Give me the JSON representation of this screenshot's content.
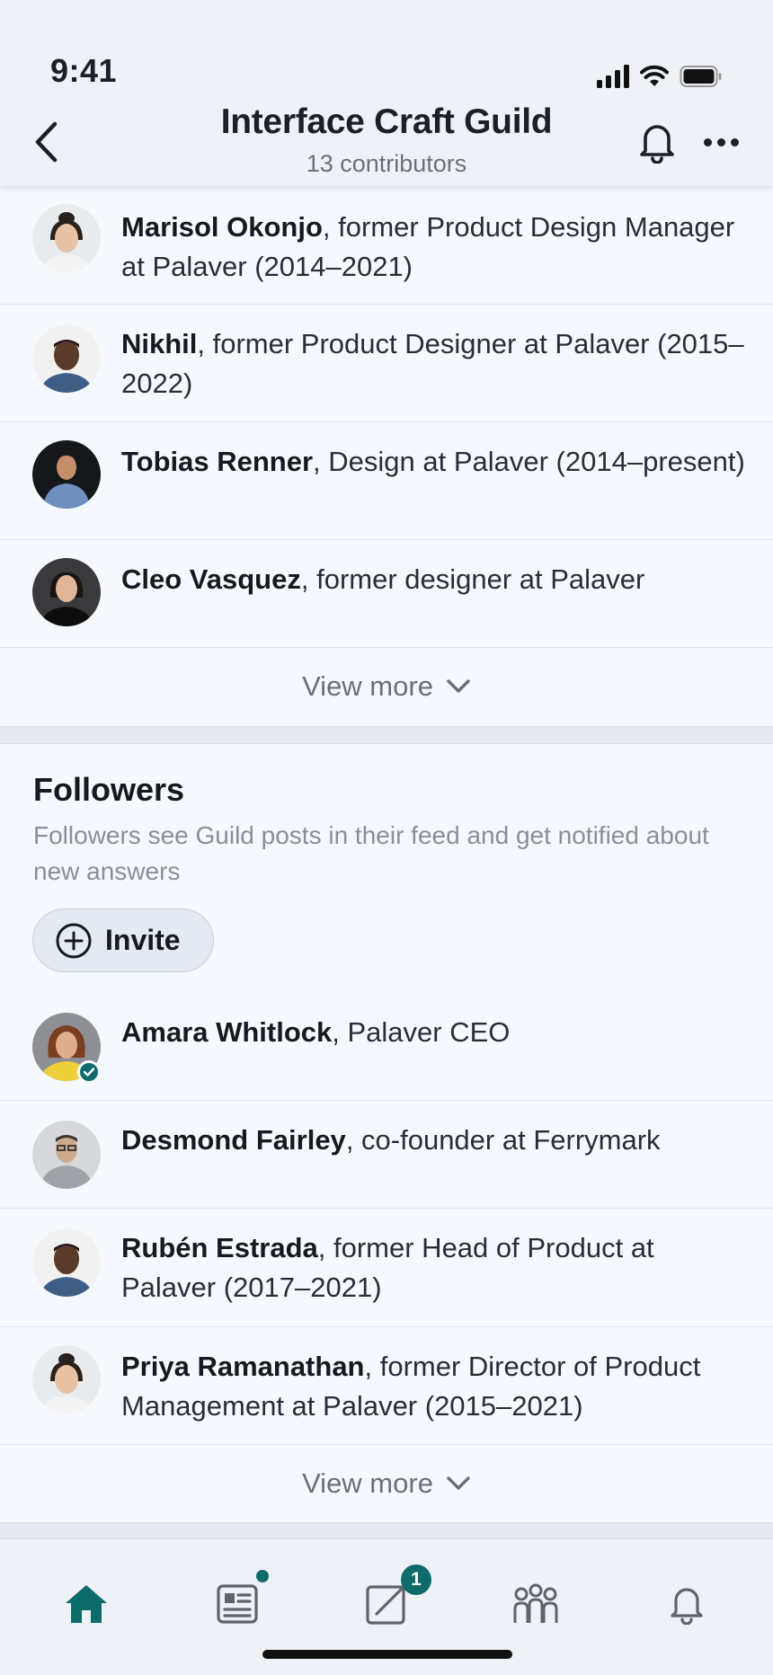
{
  "status_bar": {
    "time": "9:41"
  },
  "header": {
    "title": "Interface Craft Guild",
    "subtitle": "13 contributors"
  },
  "contributors": [
    {
      "name": "Marisol Okonjo",
      "detail": ", former Product Design Manager at Palaver (2014–2021)"
    },
    {
      "name": "Nikhil",
      "detail": ", former Product Designer at Palaver (2015–2022)"
    },
    {
      "name": "Tobias Renner",
      "detail": ", Design at Palaver (2014–present)"
    },
    {
      "name": "Cleo Vasquez",
      "detail": ", former designer at Palaver"
    }
  ],
  "contributors_view_more": "View more",
  "followers": {
    "title": "Followers",
    "description": "Followers see Guild posts in their feed and get notified about new answers",
    "invite_label": "Invite",
    "items": [
      {
        "name": "Amara Whitlock",
        "detail": ", Palaver CEO"
      },
      {
        "name": "Desmond Fairley",
        "detail": ", co-founder at Ferrymark"
      },
      {
        "name": "Rubén Estrada",
        "detail": ", former Head of Product at Palaver (2017–2021)"
      },
      {
        "name": "Priya Ramanathan",
        "detail": ", former Director of Product Management at Palaver (2015–2021)"
      }
    ],
    "view_more": "View more"
  },
  "tabbar": {
    "notes_badge": "1"
  },
  "colors": {
    "accent": "#0e6b6b",
    "background": "#f5f9fd",
    "header_bg": "#eef2f7"
  }
}
